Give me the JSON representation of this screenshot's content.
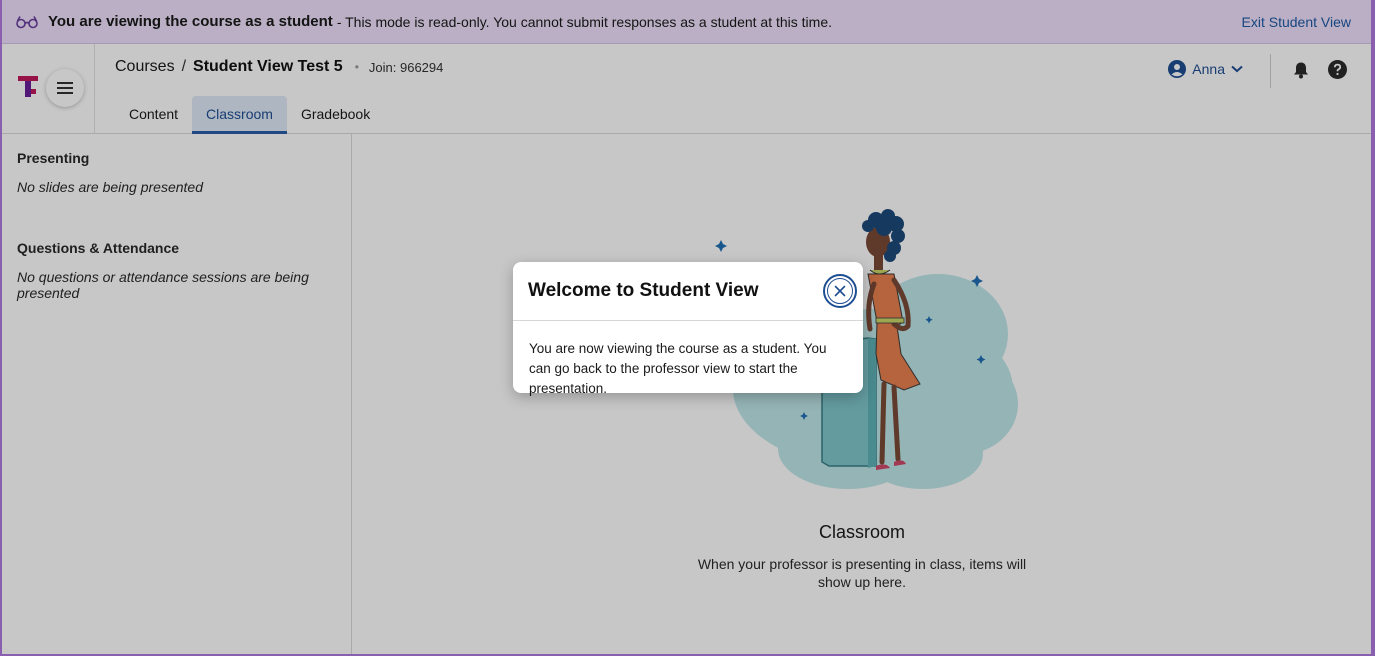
{
  "banner": {
    "strong": "You are viewing the course as a student",
    "message": "- This mode is read-only. You cannot submit responses as a student at this time.",
    "exit_label": "Exit Student View"
  },
  "header": {
    "breadcrumb": {
      "root": "Courses",
      "separator": "/",
      "current": "Student View Test 5"
    },
    "join_code": "Join: 966294",
    "tabs": [
      {
        "label": "Content",
        "active": false
      },
      {
        "label": "Classroom",
        "active": true
      },
      {
        "label": "Gradebook",
        "active": false
      }
    ],
    "user_name": "Anna"
  },
  "sidebar": {
    "presenting_heading": "Presenting",
    "presenting_text": "No slides are being presented",
    "questions_heading": "Questions & Attendance",
    "questions_text": "No questions or attendance sessions are being presented"
  },
  "main": {
    "title": "Classroom",
    "description": "When your professor is presenting in class, items will show up here."
  },
  "modal": {
    "title": "Welcome to Student View",
    "body": "You are now viewing the course as a student. You can go back to the professor view to start the presentation."
  },
  "colors": {
    "banner_bg": "#efe1fb",
    "accent": "#1f4f93",
    "frame": "#8b5fb0",
    "logo_pink": "#c2185b"
  }
}
